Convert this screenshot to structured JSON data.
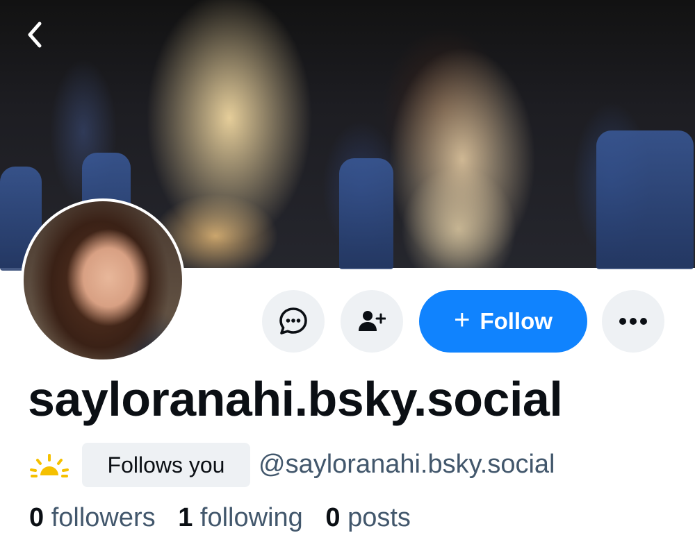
{
  "banner": {
    "image": "banner-photo"
  },
  "navigation": {
    "back_icon": "chevron-left-icon"
  },
  "avatar": {
    "image": "avatar-photo"
  },
  "actions": {
    "message_icon": "chat-bubble-icon",
    "add_user_icon": "user-plus-icon",
    "follow_plus": "+",
    "follow_label": "Follow",
    "more_icon": "ellipsis-icon",
    "follow_color": "#1083fe"
  },
  "profile": {
    "display_name": "sayloranahi.bsky.social",
    "status_icon": "sun-icon",
    "follows_you_label": "Follows you",
    "handle": "@sayloranahi.bsky.social"
  },
  "stats": {
    "followers_count": "0",
    "followers_label": "followers",
    "following_count": "1",
    "following_label": "following",
    "posts_count": "0",
    "posts_label": "posts"
  }
}
